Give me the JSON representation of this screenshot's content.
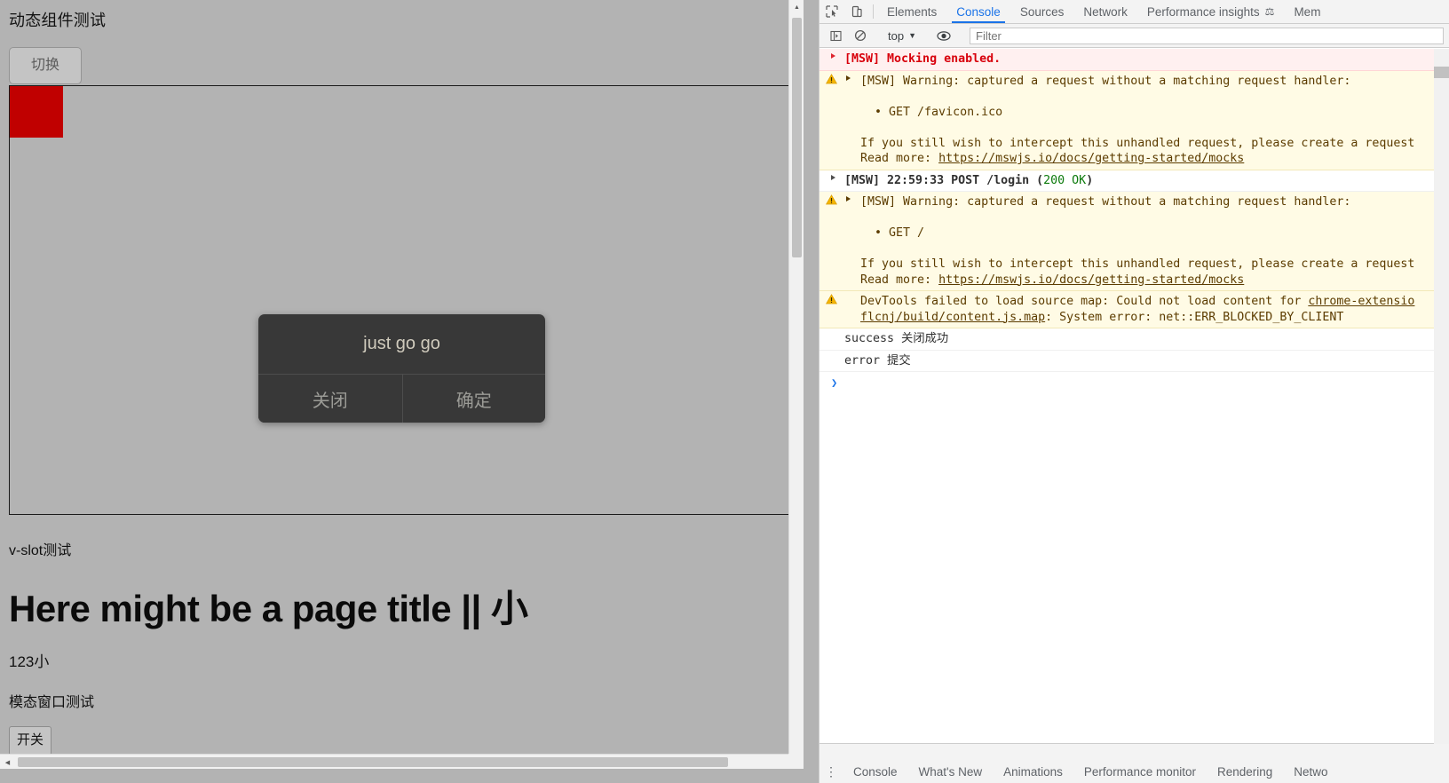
{
  "page": {
    "title": "动态组件测试",
    "toggle_button": "切换",
    "modal": {
      "message": "just go go",
      "close_button": "关闭",
      "confirm_button": "确定"
    },
    "vslot_label": "v-slot测试",
    "big_title": "Here might be a page title || 小",
    "number_label": "123小",
    "modal_test_label": "模态窗口测试",
    "switch_button": "开关",
    "colors": {
      "background": "#b3b3b3",
      "red_square": "#c00000",
      "modal_background": "#383838"
    }
  },
  "devtools": {
    "tabs": [
      {
        "label": "Elements",
        "active": false,
        "beaker": false
      },
      {
        "label": "Console",
        "active": true,
        "beaker": false
      },
      {
        "label": "Sources",
        "active": false,
        "beaker": false
      },
      {
        "label": "Network",
        "active": false,
        "beaker": false
      },
      {
        "label": "Performance insights",
        "active": false,
        "beaker": true
      },
      {
        "label": "Mem",
        "active": false,
        "beaker": false
      }
    ],
    "toolbar": {
      "inspect_icon": "inspect-element-icon",
      "device_icon": "device-toolbar-icon",
      "sidebar_icon": "console-sidebar-icon",
      "clear_icon": "clear-console-icon",
      "context_value": "top",
      "eye_icon": "live-expression-icon",
      "filter_placeholder": "Filter"
    },
    "console_logs": [
      {
        "type": "error",
        "expandable": true,
        "lines": [
          [
            {
              "t": "[MSW] Mocking enabled.",
              "style": "bold"
            }
          ]
        ]
      },
      {
        "type": "warning",
        "expandable": true,
        "lines": [
          [
            {
              "t": "[MSW] Warning: captured a request without a matching request handler:",
              "style": "plain"
            }
          ],
          [
            {
              "t": "",
              "style": "plain"
            }
          ],
          [
            {
              "t": "  • GET /favicon.ico",
              "style": "plain"
            }
          ],
          [
            {
              "t": "",
              "style": "plain"
            }
          ],
          [
            {
              "t": "If you still wish to intercept this unhandled request, please create a request",
              "style": "plain"
            }
          ],
          [
            {
              "t": "Read more: ",
              "style": "plain"
            },
            {
              "t": "https://mswjs.io/docs/getting-started/mocks",
              "style": "link"
            }
          ]
        ]
      },
      {
        "type": "info",
        "expandable": true,
        "lines": [
          [
            {
              "t": "[MSW] 22:59:33 POST /login (",
              "style": "bold"
            },
            {
              "t": "200 OK",
              "style": "green"
            },
            {
              "t": ")",
              "style": "bold"
            }
          ]
        ]
      },
      {
        "type": "warning",
        "expandable": true,
        "lines": [
          [
            {
              "t": "[MSW] Warning: captured a request without a matching request handler:",
              "style": "plain"
            }
          ],
          [
            {
              "t": "",
              "style": "plain"
            }
          ],
          [
            {
              "t": "  • GET /",
              "style": "plain"
            }
          ],
          [
            {
              "t": "",
              "style": "plain"
            }
          ],
          [
            {
              "t": "If you still wish to intercept this unhandled request, please create a request",
              "style": "plain"
            }
          ],
          [
            {
              "t": "Read more: ",
              "style": "plain"
            },
            {
              "t": "https://mswjs.io/docs/getting-started/mocks",
              "style": "link"
            }
          ]
        ]
      },
      {
        "type": "warning",
        "expandable": false,
        "lines": [
          [
            {
              "t": "DevTools failed to load source map: Could not load content for ",
              "style": "plain"
            },
            {
              "t": "chrome-extensio",
              "style": "link"
            }
          ],
          [
            {
              "t": "flcnj/build/content.js.map",
              "style": "link"
            },
            {
              "t": ": System error: net::ERR_BLOCKED_BY_CLIENT",
              "style": "plain"
            }
          ]
        ]
      },
      {
        "type": "plain",
        "expandable": false,
        "lines": [
          [
            {
              "t": "success 关闭成功",
              "style": "plain"
            }
          ]
        ]
      },
      {
        "type": "plain",
        "expandable": false,
        "lines": [
          [
            {
              "t": "error 提交",
              "style": "plain"
            }
          ]
        ]
      }
    ],
    "prompt_caret": "❯",
    "drawer_tabs": [
      "Console",
      "What's New",
      "Animations",
      "Performance monitor",
      "Rendering",
      "Netwo"
    ],
    "colors": {
      "accent": "#1a73e8",
      "error_text": "#d8000c",
      "error_bg": "#fff0f0",
      "warning_bg": "#fffbe5",
      "success_green": "#0b7a0b"
    }
  }
}
